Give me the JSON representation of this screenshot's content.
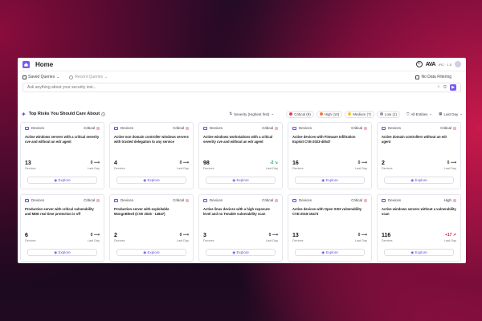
{
  "header": {
    "title": "Home",
    "logo_text": "AVA",
    "logo_sub": "IRC · 1.5"
  },
  "querybar": {
    "saved_queries": "Saved Queries",
    "recent_queries": "Recent Queries",
    "data_filtering": "No Data Filtering"
  },
  "ask": {
    "placeholder": "Ask anything about your security inst..."
  },
  "risks": {
    "title": "Top Risks You Should Care About",
    "sort_label": "Severity (Highest first)",
    "chips": [
      {
        "label": "Critical (9)",
        "color": "#e23d5a"
      },
      {
        "label": "High (10)",
        "color": "#f07a3a"
      },
      {
        "label": "Medium (7)",
        "color": "#f2c230"
      },
      {
        "label": "Low (1)",
        "color": "#9a9aa8"
      }
    ],
    "entities_label": "All Entities",
    "period_label": "Last Day"
  },
  "cards": [
    {
      "category": "Devices",
      "severity": "Critical",
      "description": "Active windows servers with a critical severity cve and without an edr agent",
      "count": "13",
      "count_label": "Devices",
      "trend": "0 ⟶",
      "trend_dir": "flat",
      "trend_label": "Last Day",
      "explore": "Explore"
    },
    {
      "category": "Devices",
      "severity": "Critical",
      "description": "Active non domain controller windows servers with trusted delegation to any service",
      "count": "4",
      "count_label": "Devices",
      "trend": "0 ⟶",
      "trend_dir": "flat",
      "trend_label": "Last Day",
      "explore": "Explore"
    },
    {
      "category": "Devices",
      "severity": "Critical",
      "description": "Active windows workstations with a critical severity cve and without an edr agent",
      "count": "98",
      "count_label": "Devices",
      "trend": "-2 ↘",
      "trend_dir": "down",
      "trend_label": "Last Day",
      "explore": "Explore"
    },
    {
      "category": "Devices",
      "severity": "Critical",
      "description": "Active devices with Fimware Infiltration Exploit CVE-2023-40547",
      "count": "16",
      "count_label": "Devices",
      "trend": "0 ⟶",
      "trend_dir": "flat",
      "trend_label": "Last Day",
      "explore": "Explore"
    },
    {
      "category": "Devices",
      "severity": "Critical",
      "description": "Active domain controllers without an edr agent",
      "count": "2",
      "count_label": "Devices",
      "trend": "0 ⟶",
      "trend_dir": "flat",
      "trend_label": "Last Day",
      "explore": "Explore"
    },
    {
      "category": "Devices",
      "severity": "Critical",
      "description": "Production server with critical vulnerability and MDE real time protection is off",
      "count": "6",
      "count_label": "Devices",
      "trend": "0 ⟶",
      "trend_dir": "flat",
      "trend_label": "Last Day",
      "explore": "Explore"
    },
    {
      "category": "Devices",
      "severity": "Critical",
      "description": "Production server with exploitable MongoBleed (CVE 2025 - 14847)",
      "count": "2",
      "count_label": "Devices",
      "trend": "0 ⟶",
      "trend_dir": "flat",
      "trend_label": "Last Day",
      "explore": "Explore"
    },
    {
      "category": "Devices",
      "severity": "Critical",
      "description": "Active linux devices with a high exposure level and no Tenable vulnerability scan",
      "count": "3",
      "count_label": "Devices",
      "trend": "0 ⟶",
      "trend_dir": "flat",
      "trend_label": "Last Day",
      "explore": "Explore"
    },
    {
      "category": "Devices",
      "severity": "Critical",
      "description": "Active devices with Open SSH vulnerability CVE-2018-15473",
      "count": "13",
      "count_label": "Devices",
      "trend": "0 ⟶",
      "trend_dir": "flat",
      "trend_label": "Last Day",
      "explore": "Explore"
    },
    {
      "category": "Devices",
      "severity": "High",
      "description": "Active windows servers without a vulnerability scan",
      "count": "116",
      "count_label": "Devices",
      "trend": "+17 ↗",
      "trend_dir": "up",
      "trend_label": "Last Day",
      "explore": "Explore"
    }
  ]
}
